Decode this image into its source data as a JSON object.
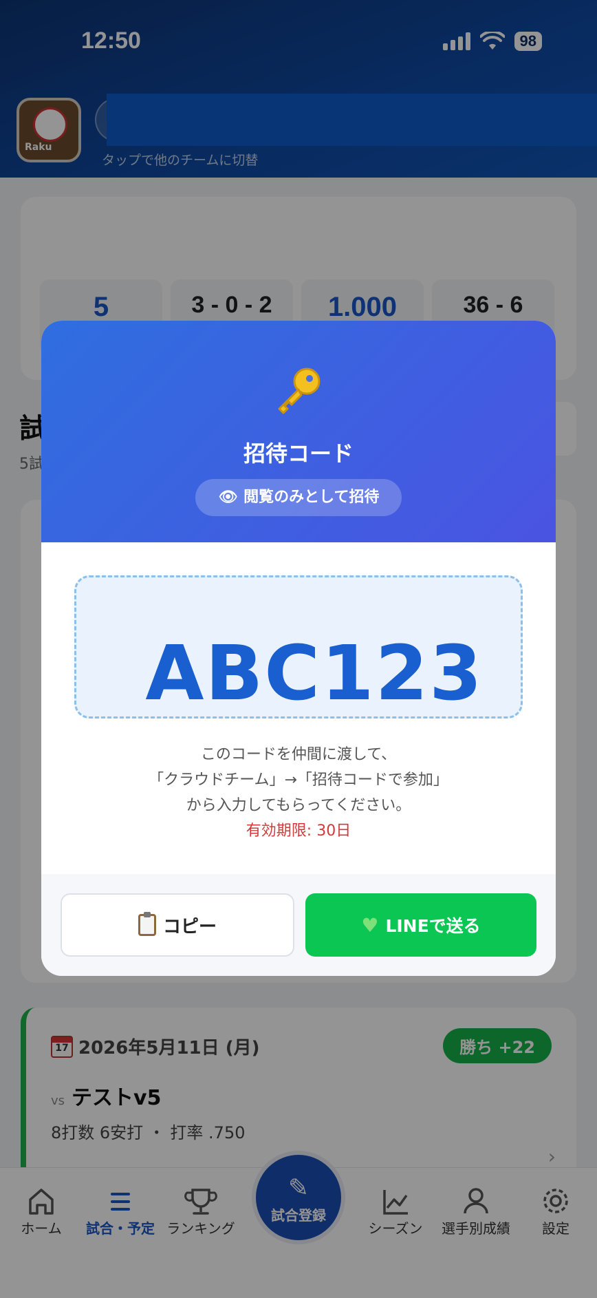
{
  "status_bar": {
    "time": "12:50",
    "battery": "98"
  },
  "header": {
    "app_icon_label": "Raku",
    "team_hint": "タップで他のチームに切替"
  },
  "stats": [
    {
      "value": "5"
    },
    {
      "value": "3 - 0 - 2"
    },
    {
      "value": "1.000"
    },
    {
      "value": "36 - 6"
    }
  ],
  "section": {
    "title": "試",
    "subtitle": "5試"
  },
  "game": {
    "date": "2026年5月11日 (月)",
    "calendar_day": "17",
    "result": "勝ち +22",
    "vs_label": "vs",
    "opponent": "テストv5",
    "stats_line": "8打数 6安打 ・ 打率 .750"
  },
  "modal": {
    "title": "招待コード",
    "badge": "閲覧のみとして招待",
    "code": "ABC123",
    "instructions_1": "このコードを仲間に渡して、",
    "instructions_2": "「クラウドチーム」→「招待コードで参加」",
    "instructions_3": "から入力してもらってください。",
    "expiry": "有効期限: 30日",
    "copy_label": "コピー",
    "line_label": "LINEで送る"
  },
  "nav": {
    "home": "ホーム",
    "games": "試合・予定",
    "ranking": "ランキング",
    "register": "試合登録",
    "season": "シーズン",
    "players": "選手別成績",
    "settings": "設定"
  },
  "colors": {
    "header": "#0f4aa5",
    "accent": "#1a56c8",
    "line_green": "#0bc653",
    "win_green": "#17b24a",
    "expiry_red": "#d23a3a"
  }
}
